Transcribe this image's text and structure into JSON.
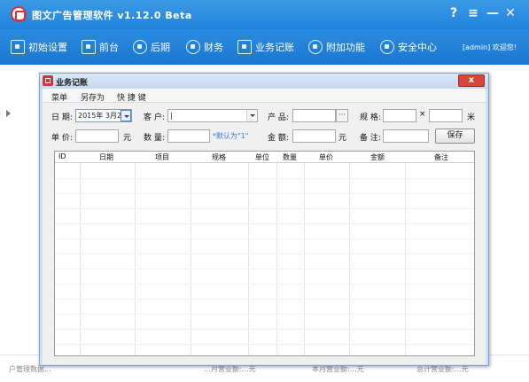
{
  "app": {
    "title": "图文广告管理软件  v1.12.0 Beta",
    "controls": [
      "?",
      "≡",
      "—",
      "✕"
    ]
  },
  "toolbar": {
    "items": [
      {
        "label": "初始设置",
        "icon": "monitor-icon"
      },
      {
        "label": "前台",
        "icon": "monitor-icon"
      },
      {
        "label": "后期",
        "icon": "wave-icon"
      },
      {
        "label": "财务",
        "icon": "money-icon"
      },
      {
        "label": "业务记账",
        "icon": "edit-icon"
      },
      {
        "label": "附加功能",
        "icon": "gear-icon"
      },
      {
        "label": "安全中心",
        "icon": "shield-icon"
      }
    ],
    "user": "[admin] 欢迎您!"
  },
  "dialog": {
    "title": "业务记账",
    "close": "x",
    "menu": [
      "菜单",
      "另存为",
      "快 捷 键"
    ],
    "form": {
      "date_label": "日 期:",
      "date_value": "2015年 3月25日",
      "customer_label": "客 户:",
      "customer_value": "|",
      "product_label": "产 品:",
      "product_value": "",
      "product_browse": "···",
      "spec_label": "规 格:",
      "spec_times": "×",
      "spec_unit": "米",
      "price_label": "单 价:",
      "price_unit": "元",
      "qty_label": "数 量:",
      "qty_hint": "*默认为\"1\"",
      "amount_label": "金 额:",
      "amount_unit": "元",
      "note_label": "备 注:",
      "save_label": "保存"
    },
    "table": {
      "columns": [
        "ID",
        "日期",
        "项目",
        "规格",
        "单位",
        "数量",
        "单价",
        "金额",
        "备注"
      ],
      "rows": []
    }
  },
  "status": {
    "left": "户管理数据…",
    "mid1": "…月营业额:…元",
    "mid2": "本月营业额:…元",
    "right": "总计营业额:…元"
  }
}
